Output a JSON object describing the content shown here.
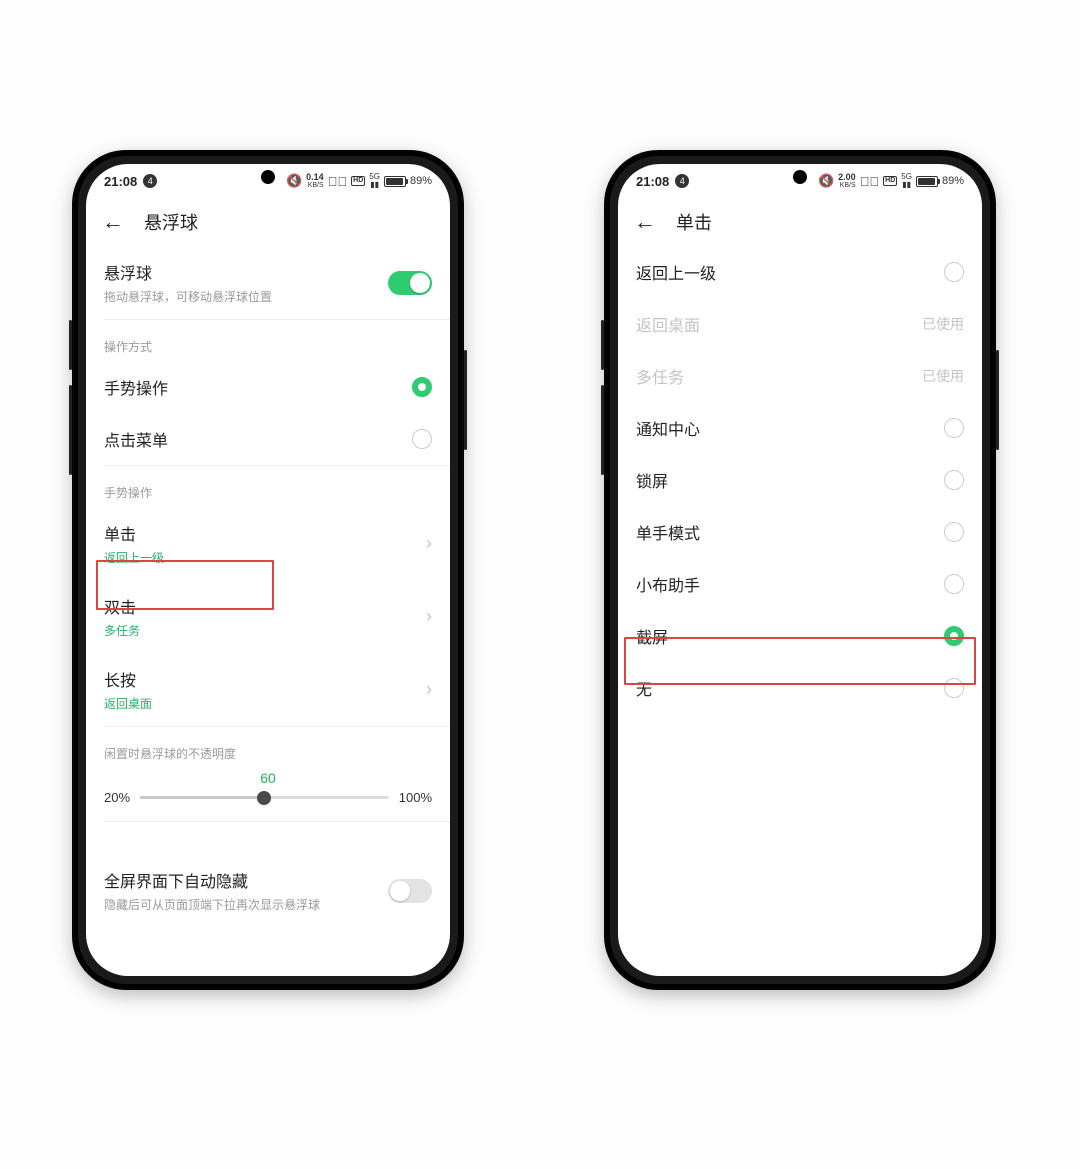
{
  "status": {
    "time": "21:08",
    "notif_count": "4",
    "net_speed_left": "0.14",
    "net_speed_right": "2.00",
    "net_unit": "KB/S",
    "hd_badge": "HD",
    "sig_top": "5G",
    "battery_pct": "89%"
  },
  "left": {
    "title": "悬浮球",
    "main_toggle_title": "悬浮球",
    "main_toggle_sub": "拖动悬浮球，可移动悬浮球位置",
    "section_operation": "操作方式",
    "op_gesture": "手势操作",
    "op_menu": "点击菜单",
    "section_gesture": "手势操作",
    "g_single_title": "单击",
    "g_single_sub": "返回上一级",
    "g_double_title": "双击",
    "g_double_sub": "多任务",
    "g_long_title": "长按",
    "g_long_sub": "返回桌面",
    "section_opacity": "闲置时悬浮球的不透明度",
    "slider_value": "60",
    "slider_min": "20%",
    "slider_max": "100%",
    "autohide_title": "全屏界面下自动隐藏",
    "autohide_sub": "隐藏后可从页面顶端下拉再次显示悬浮球"
  },
  "right": {
    "title": "单击",
    "opt_back": "返回上一级",
    "opt_home": "返回桌面",
    "opt_tasks": "多任务",
    "used_label": "已使用",
    "opt_notif": "通知中心",
    "opt_lock": "锁屏",
    "opt_onehand": "单手模式",
    "opt_breeno": "小布助手",
    "opt_screenshot": "截屏",
    "opt_none": "无"
  }
}
